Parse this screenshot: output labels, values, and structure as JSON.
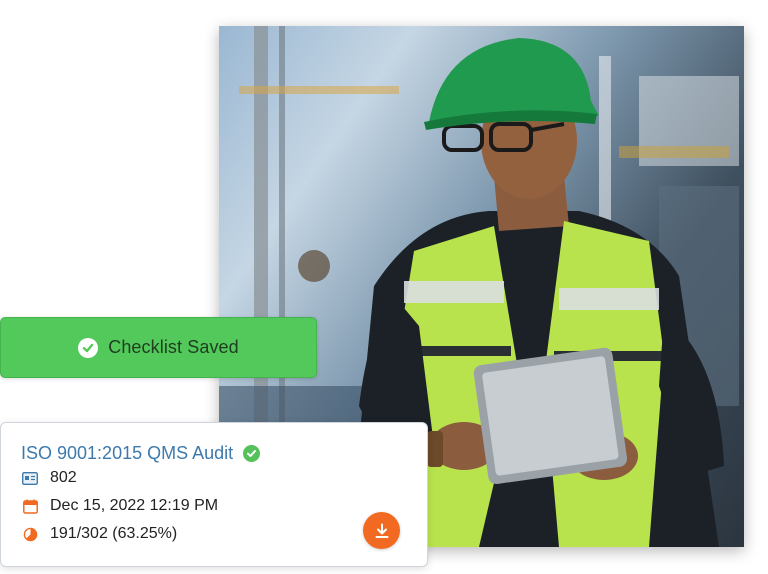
{
  "toast": {
    "message": "Checklist Saved",
    "color": "#52c95a"
  },
  "audit_card": {
    "title": "ISO 9001:2015 QMS Audit",
    "id_number": "802",
    "datetime": "Dec 15, 2022 12:19 PM",
    "progress_text": "191/302 (63.25%)",
    "progress_fraction": 0.6325,
    "title_color": "#3d79ad",
    "accent_color": "#f26a21"
  },
  "icons": {
    "toast": "check-circle-icon",
    "verified": "check-circle-icon",
    "id": "id-card-icon",
    "date": "calendar-icon",
    "progress": "pie-chart-icon",
    "download": "download-icon"
  }
}
